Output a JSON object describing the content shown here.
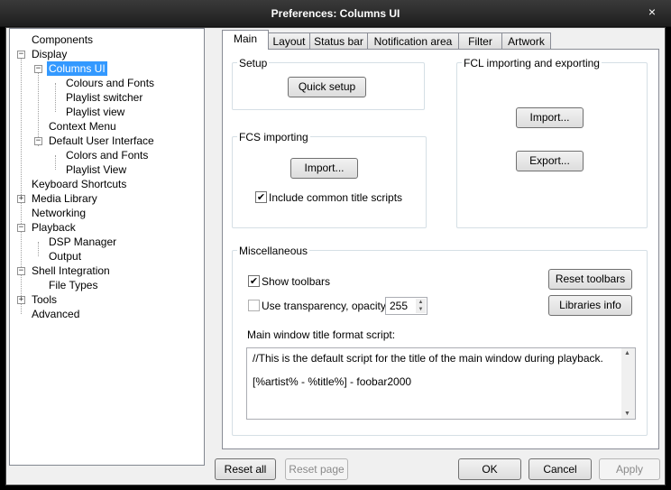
{
  "window": {
    "title": "Preferences: Columns UI",
    "close": "×"
  },
  "tree": {
    "items": [
      {
        "label": "Components"
      },
      {
        "label": "Display",
        "expander": "−"
      },
      {
        "label": "Columns UI",
        "expander": "−"
      },
      {
        "label": "Colours and Fonts"
      },
      {
        "label": "Playlist switcher"
      },
      {
        "label": "Playlist view"
      },
      {
        "label": "Context Menu"
      },
      {
        "label": "Default User Interface",
        "expander": "−"
      },
      {
        "label": "Colors and Fonts"
      },
      {
        "label": "Playlist View"
      },
      {
        "label": "Keyboard Shortcuts"
      },
      {
        "label": "Media Library",
        "expander": "+"
      },
      {
        "label": "Networking"
      },
      {
        "label": "Playback",
        "expander": "−"
      },
      {
        "label": "DSP Manager"
      },
      {
        "label": "Output"
      },
      {
        "label": "Shell Integration",
        "expander": "−"
      },
      {
        "label": "File Types"
      },
      {
        "label": "Tools",
        "expander": "+"
      },
      {
        "label": "Advanced"
      }
    ]
  },
  "tabs": [
    "Main",
    "Layout",
    "Status bar",
    "Notification area",
    "Filter",
    "Artwork"
  ],
  "setup": {
    "legend": "Setup",
    "quick_setup": "Quick setup"
  },
  "fcl": {
    "legend": "FCL importing and exporting",
    "import": "Import...",
    "export": "Export..."
  },
  "fcs": {
    "legend": "FCS importing",
    "import": "Import...",
    "include_label": "Include common title scripts",
    "include_checked": "✔"
  },
  "misc": {
    "legend": "Miscellaneous",
    "show_toolbars": "Show toolbars",
    "show_toolbars_checked": "✔",
    "use_transparency": "Use transparency, opacity",
    "opacity": "255",
    "reset_toolbars": "Reset toolbars",
    "libraries_info": "Libraries info",
    "title_format_label": "Main window title format script:",
    "script_line1": "//This is the default script for the title of the main window during playback.",
    "script_line2": "[%artist% - %title%] - foobar2000"
  },
  "footer": {
    "reset_all": "Reset all",
    "reset_page": "Reset page",
    "ok": "OK",
    "cancel": "Cancel",
    "apply": "Apply"
  },
  "icons": {
    "spin_up": "▲",
    "spin_down": "▼",
    "scroll_up": "▲",
    "scroll_down": "▼"
  }
}
